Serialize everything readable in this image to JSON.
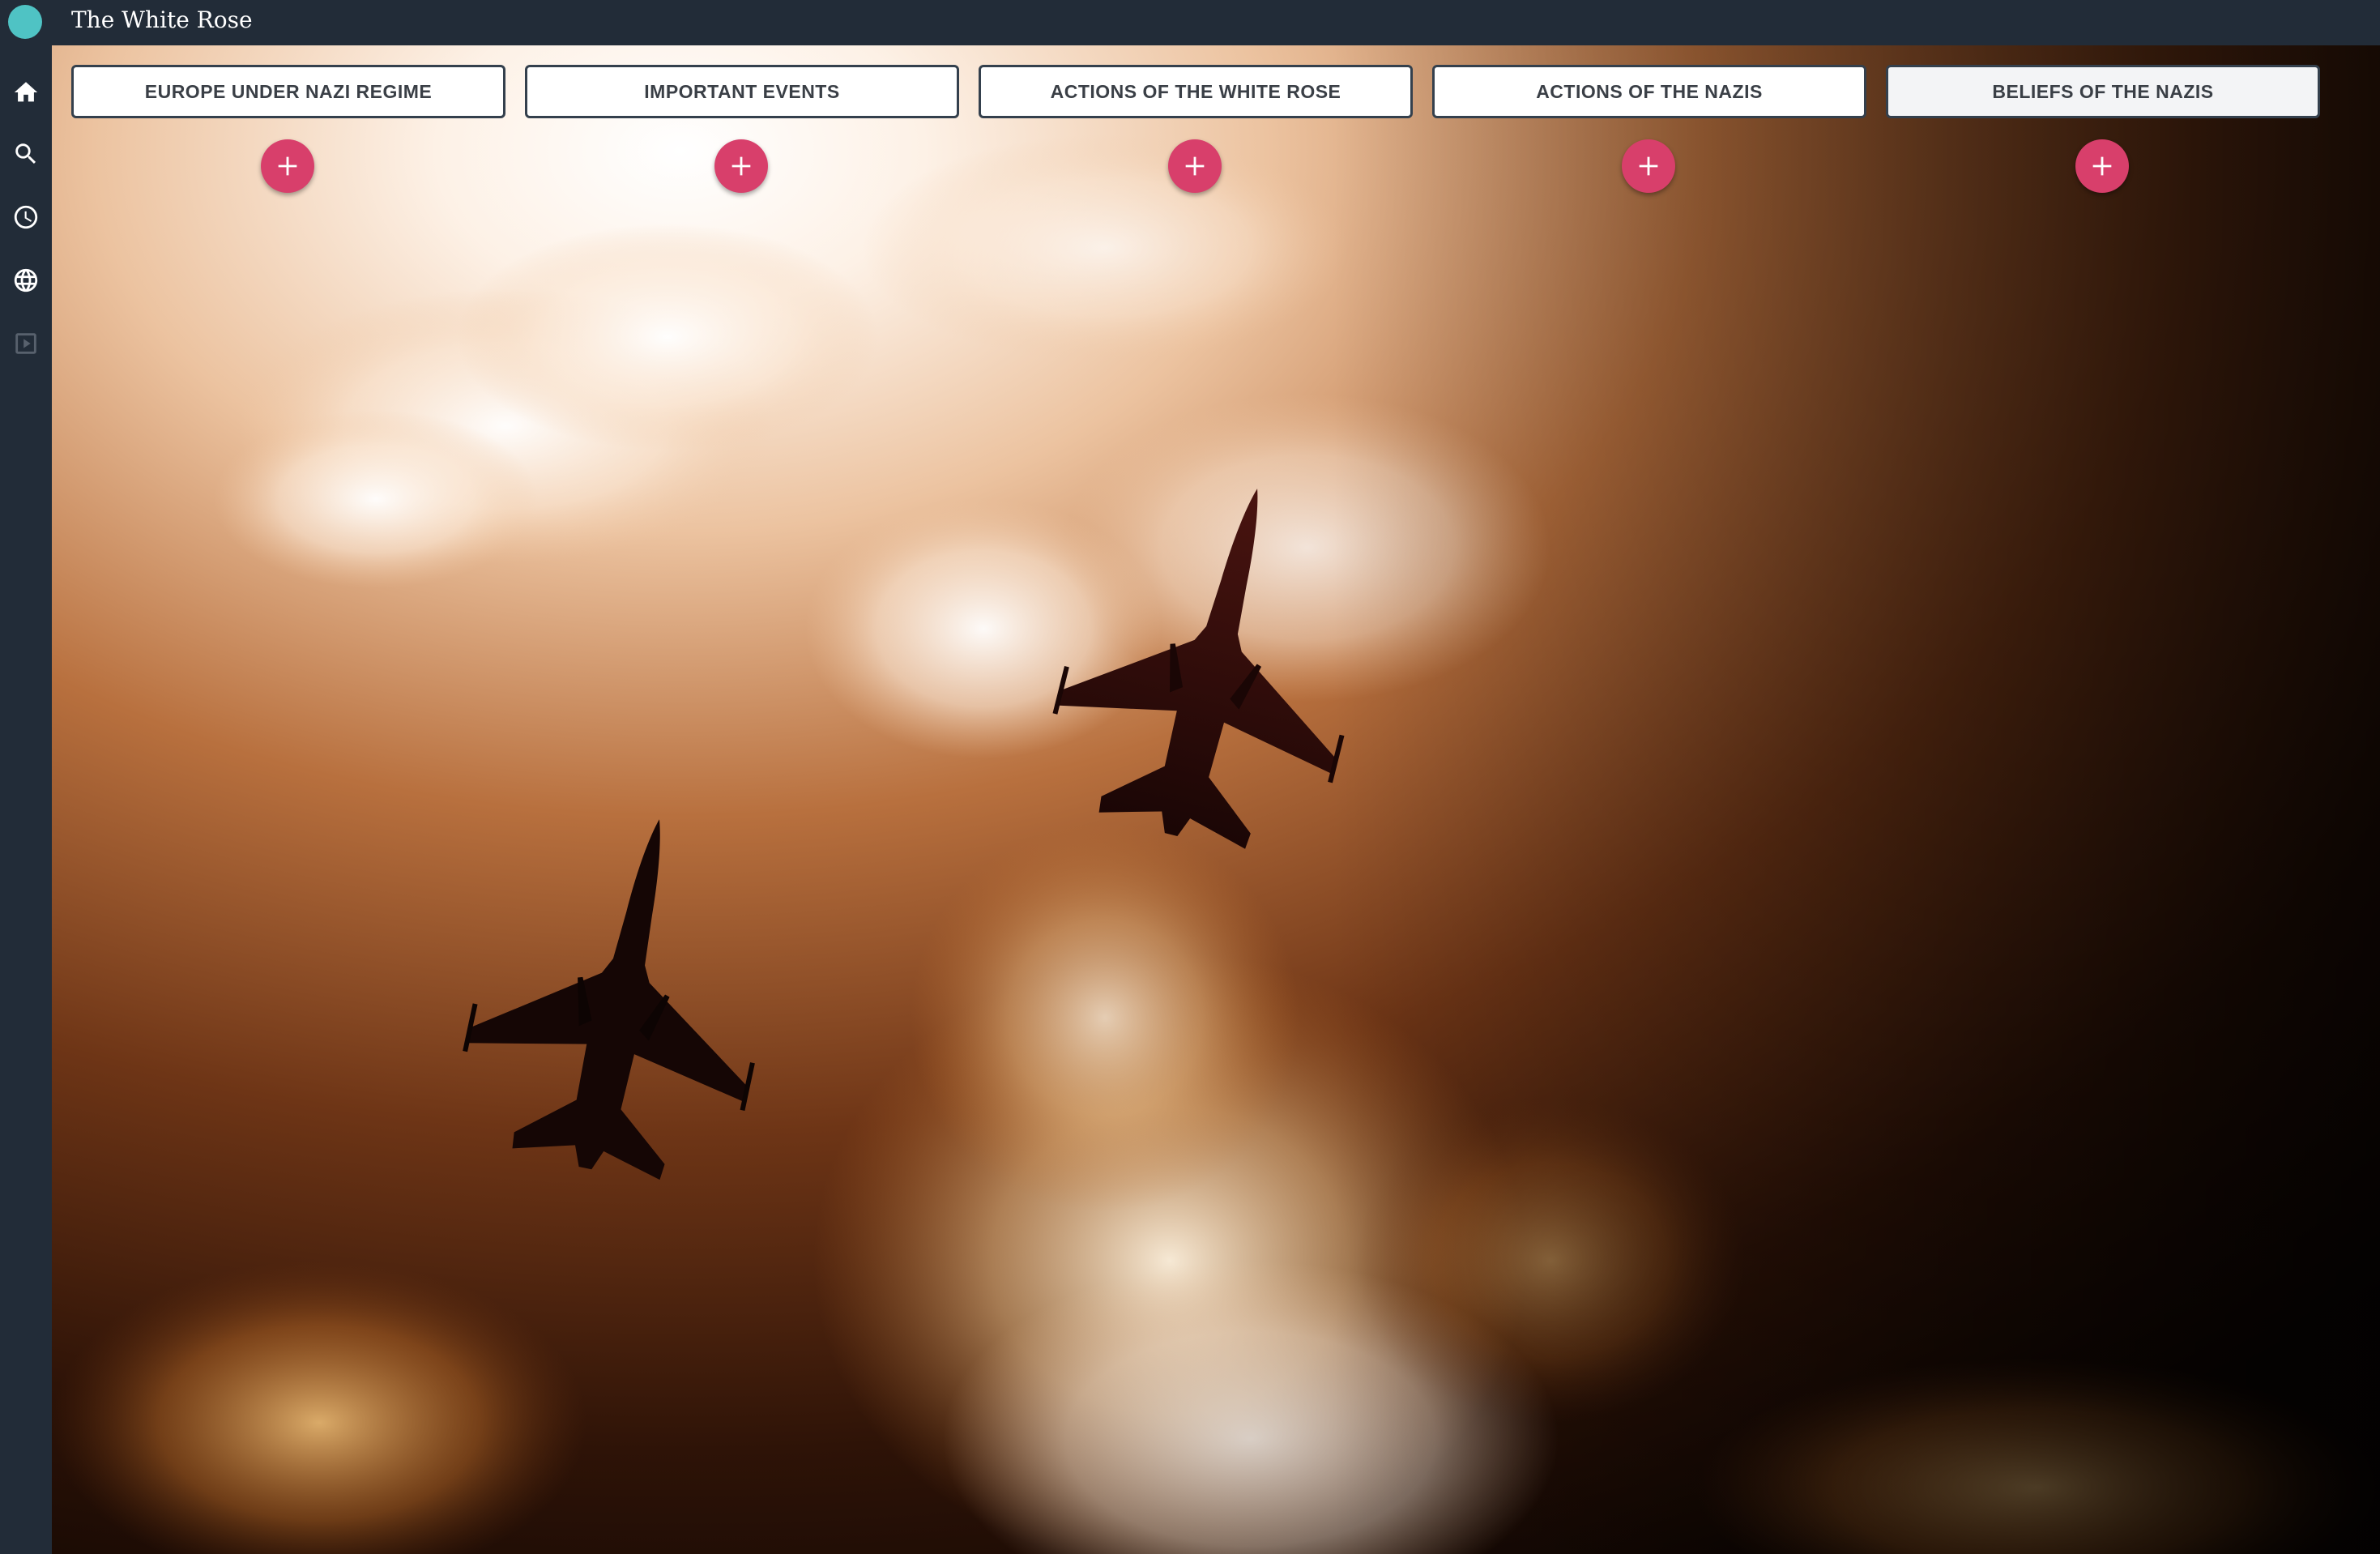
{
  "app": {
    "title": "The White Rose",
    "logo_color": "#4fc3c4",
    "bar_color": "#222c38"
  },
  "sidebar": {
    "items": [
      {
        "icon": "home-icon",
        "active": true
      },
      {
        "icon": "search-icon"
      },
      {
        "icon": "clock-icon"
      },
      {
        "icon": "globe-icon"
      },
      {
        "icon": "presentation-icon",
        "disabled": true
      }
    ]
  },
  "categories": [
    {
      "label": "EUROPE UNDER NAZI REGIME",
      "add_icon": "plus-icon"
    },
    {
      "label": "IMPORTANT EVENTS",
      "add_icon": "plus-icon"
    },
    {
      "label": "ACTIONS OF THE WHITE ROSE",
      "add_icon": "plus-icon"
    },
    {
      "label": "ACTIONS OF THE NAZIS",
      "add_icon": "plus-icon"
    },
    {
      "label": "BELIEFS OF THE NAZIS",
      "add_icon": "plus-icon",
      "active": true
    }
  ],
  "colors": {
    "accent": "#d83f6b",
    "button_border": "#34404d",
    "button_text": "#3a3f46"
  },
  "background": {
    "subject": "fighter-jets-silhouette-in-cloudy-sunset-sky"
  }
}
